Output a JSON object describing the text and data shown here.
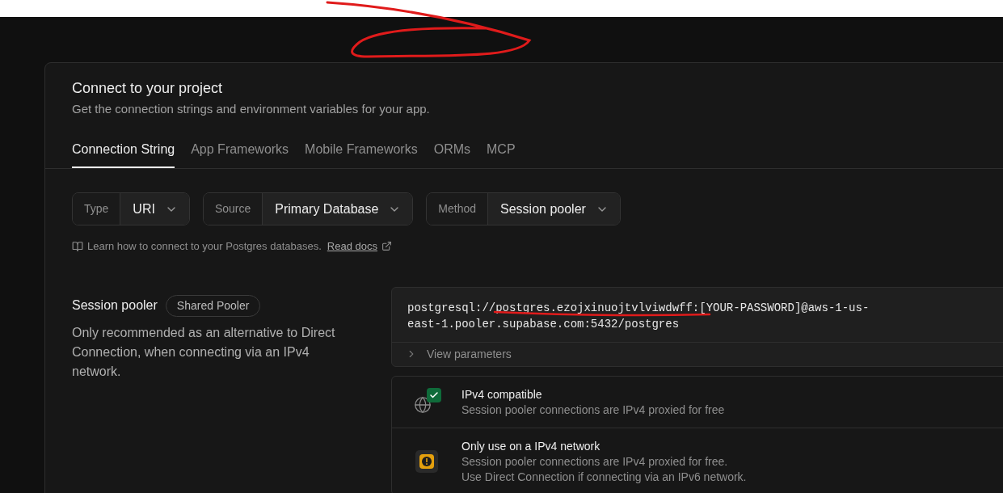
{
  "dialog": {
    "title": "Connect to your project",
    "subtitle": "Get the connection strings and environment variables for your app."
  },
  "tabs": [
    {
      "label": "Connection String",
      "selected": true
    },
    {
      "label": "App Frameworks",
      "selected": false
    },
    {
      "label": "Mobile Frameworks",
      "selected": false
    },
    {
      "label": "ORMs",
      "selected": false
    },
    {
      "label": "MCP",
      "selected": false
    }
  ],
  "selectors": [
    {
      "label": "Type",
      "value": "URI"
    },
    {
      "label": "Source",
      "value": "Primary Database"
    },
    {
      "label": "Method",
      "value": "Session pooler"
    }
  ],
  "docs_hint": {
    "text": "Learn how to connect to your Postgres databases.",
    "link": "Read docs"
  },
  "connection": {
    "title": "Session pooler",
    "badge": "Shared Pooler",
    "description": "Only recommended as an alternative to Direct Connection, when connecting via an IPv4 network.",
    "string": "postgresql://postgres.ezojxinuojtvlviwdwff:[YOUR-PASSWORD]@aws-1-us-east-1.pooler.supabase.com:5432/postgres",
    "parameters": {
      "label": "View parameters",
      "expanded": false
    }
  },
  "notices": [
    {
      "kind": "success",
      "title": "IPv4 compatible",
      "lines": [
        "Session pooler connections are IPv4 proxied for free"
      ]
    },
    {
      "kind": "warning",
      "title": "Only use on a IPv4 network",
      "lines": [
        "Session pooler connections are IPv4 proxied for free.",
        "Use Direct Connection if connecting via an IPv6 network."
      ]
    }
  ]
}
